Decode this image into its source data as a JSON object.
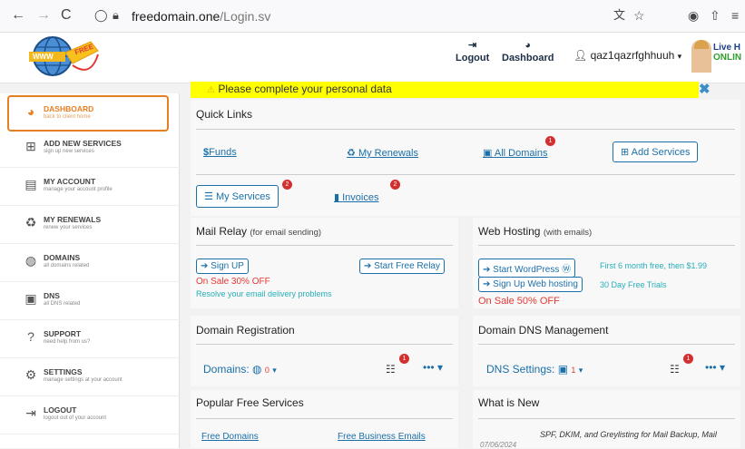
{
  "browser": {
    "back": "←",
    "forward": "→",
    "reload": "C",
    "url_domain": "freedomain.one",
    "url_path": "/Login.sv"
  },
  "header": {
    "logo_text": "WWW",
    "logo_tag": "FREE",
    "logout": "Logout",
    "dashboard": "Dashboard",
    "username": "qaz1qazrfghhuuh",
    "live_line1": "Live H",
    "live_line2": "ONLIN"
  },
  "sidebar": {
    "items": [
      {
        "title": "DASHBOARD",
        "sub": "back to client home",
        "icon": "tachometer-icon"
      },
      {
        "title": "ADD NEW SERVICES",
        "sub": "sign up new services",
        "icon": "plus-square-icon"
      },
      {
        "title": "MY ACCOUNT",
        "sub": "manage your account profile",
        "icon": "id-card-icon"
      },
      {
        "title": "MY RENEWALS",
        "sub": "renew your services",
        "icon": "recycle-icon"
      },
      {
        "title": "DOMAINS",
        "sub": "all domains related",
        "icon": "globe-icon"
      },
      {
        "title": "DNS",
        "sub": "all DNS related",
        "icon": "dns-icon"
      },
      {
        "title": "SUPPORT",
        "sub": "need help from us?",
        "icon": "question-icon"
      },
      {
        "title": "SETTINGS",
        "sub": "manage settings at your account",
        "icon": "cogs-icon"
      },
      {
        "title": "LOGOUT",
        "sub": "logout out of your account",
        "icon": "sign-out-icon"
      }
    ]
  },
  "notice": {
    "text": "Please complete your personal data"
  },
  "quick_links": {
    "title": "Quick Links",
    "funds": "Funds",
    "renewals": "My Renewals",
    "all_domains": "All Domains",
    "all_domains_badge": "1",
    "add_services": "Add Services",
    "my_services": "My Services",
    "my_services_badge": "2",
    "invoices": "Invoices",
    "invoices_badge": "2"
  },
  "mail_relay": {
    "title": "Mail Relay",
    "title_note": "(for email sending)",
    "signup": "Sign UP",
    "start": "Start Free Relay",
    "sale": "On Sale 30% OFF",
    "note": "Resolve your email delivery problems"
  },
  "web_hosting": {
    "title": "Web Hosting",
    "title_note": "(with emails)",
    "start_wp": "Start WordPress",
    "signup_web": "Sign Up Web hosting",
    "sale": "On Sale 50% OFF",
    "promo1": "First 6 month free, then $1.99",
    "promo2": "30 Day Free Trials"
  },
  "domain_reg": {
    "title": "Domain Registration",
    "label": "Domains:",
    "count": "0",
    "list_badge": "1"
  },
  "dns_mgmt": {
    "title": "Domain DNS Management",
    "label": "DNS Settings:",
    "count": "1",
    "list_badge": "1"
  },
  "popular": {
    "title": "Popular Free Services",
    "link1": "Free Domains",
    "link2": "Free Business Emails"
  },
  "whats_new": {
    "title": "What is New",
    "date": "07/06/2024",
    "headline": "SPF, DKIM, and Greylisting for Mail Backup, Mail"
  },
  "colors": {
    "accent": "#1a6fa8",
    "notice_bg": "#ffff00",
    "sale": "#e53935",
    "teal": "#27aeb9",
    "active": "#e67e22"
  }
}
